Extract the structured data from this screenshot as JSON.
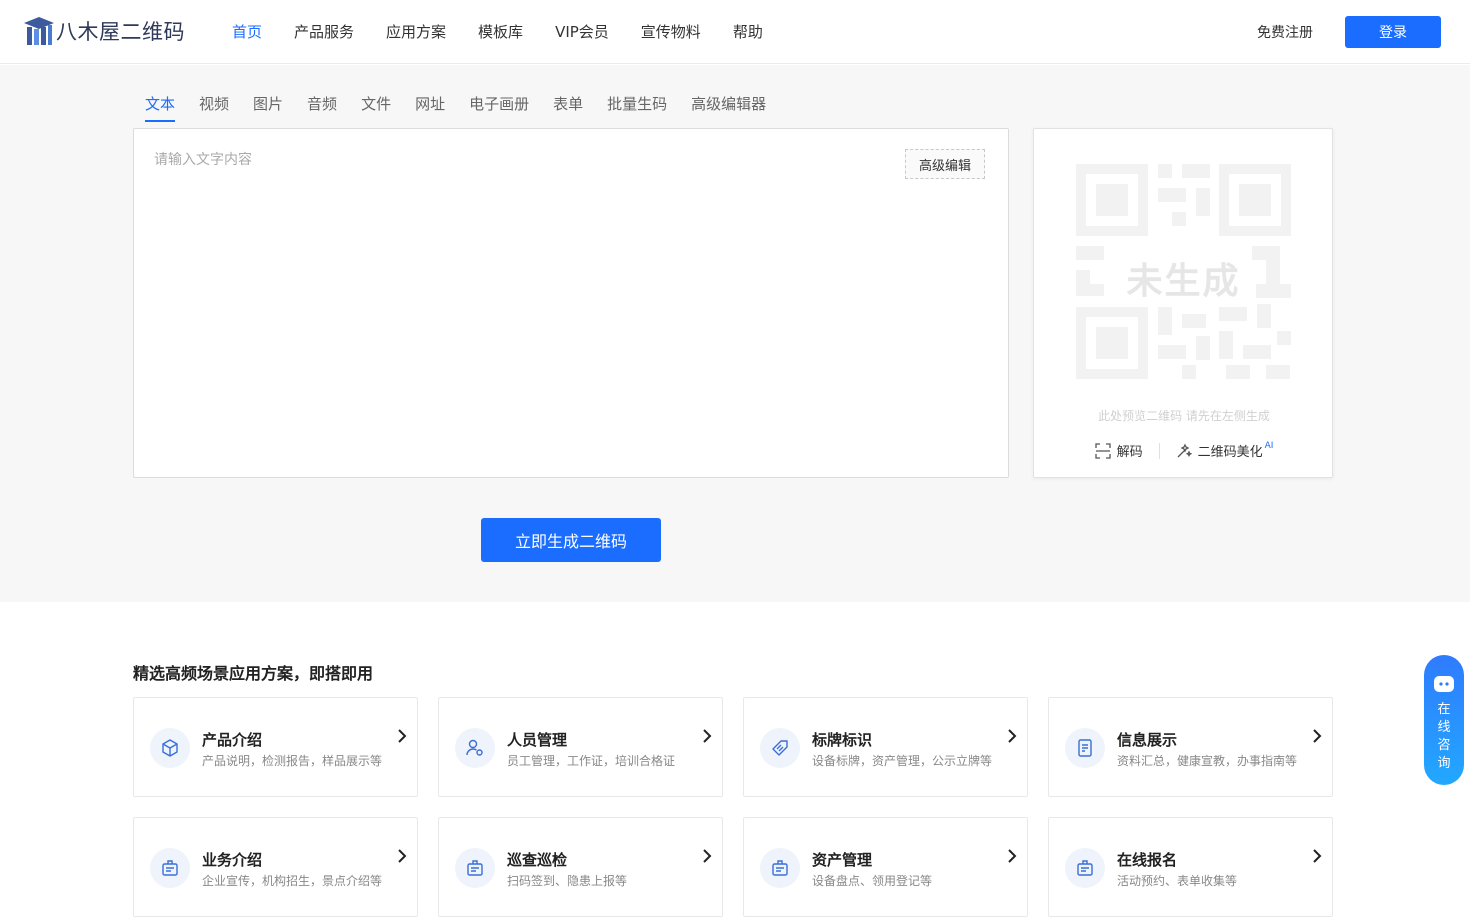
{
  "brand": {
    "name": "八木屋二维码",
    "accent": "#1a6dff"
  },
  "nav": {
    "items": [
      {
        "label": "首页",
        "active": true
      },
      {
        "label": "产品服务",
        "active": false
      },
      {
        "label": "应用方案",
        "active": false
      },
      {
        "label": "模板库",
        "active": false
      },
      {
        "label": "VIP会员",
        "active": false
      },
      {
        "label": "宣传物料",
        "active": false
      },
      {
        "label": "帮助",
        "active": false
      }
    ],
    "register": "免费注册",
    "login": "登录"
  },
  "generator": {
    "tabs": [
      {
        "label": "文本",
        "active": true
      },
      {
        "label": "视频",
        "active": false
      },
      {
        "label": "图片",
        "active": false
      },
      {
        "label": "音频",
        "active": false
      },
      {
        "label": "文件",
        "active": false
      },
      {
        "label": "网址",
        "active": false
      },
      {
        "label": "电子画册",
        "active": false
      },
      {
        "label": "表单",
        "active": false
      },
      {
        "label": "批量生码",
        "active": false
      },
      {
        "label": "高级编辑器",
        "active": false
      }
    ],
    "placeholder": "请输入文字内容",
    "value": "",
    "advanced_button": "高级编辑",
    "generate_button": "立即生成二维码"
  },
  "preview": {
    "status": "未生成",
    "tip": "此处预览二维码 请先在左侧生成",
    "decode": "解码",
    "beautify": "二维码美化",
    "ai_tag": "AI"
  },
  "scenes": {
    "title": "精选高频场景应用方案，即搭即用",
    "cards": [
      {
        "title": "产品介绍",
        "desc": "产品说明，检测报告，样品展示等",
        "icon": "cube-icon"
      },
      {
        "title": "人员管理",
        "desc": "员工管理，工作证，培训合格证",
        "icon": "user-gear-icon"
      },
      {
        "title": "标牌标识",
        "desc": "设备标牌，资产管理，公示立牌等",
        "icon": "tag-icon"
      },
      {
        "title": "信息展示",
        "desc": "资料汇总，健康宣教，办事指南等",
        "icon": "note-icon"
      },
      {
        "title": "业务介绍",
        "desc": "企业宣传，机构招生，景点介绍等",
        "icon": "badge-icon"
      },
      {
        "title": "巡查巡检",
        "desc": "扫码签到、隐患上报等",
        "icon": "badge-icon"
      },
      {
        "title": "资产管理",
        "desc": "设备盘点、领用登记等",
        "icon": "badge-icon"
      },
      {
        "title": "在线报名",
        "desc": "活动预约、表单收集等",
        "icon": "badge-icon"
      }
    ]
  },
  "consult": {
    "label": "在线咨询"
  }
}
